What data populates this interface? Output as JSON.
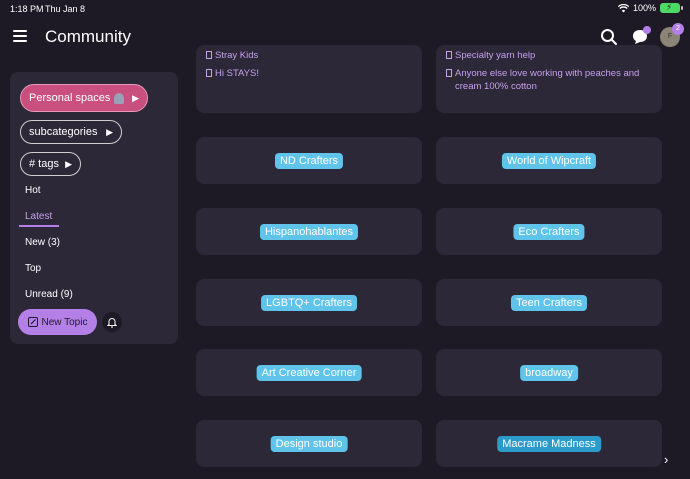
{
  "status": {
    "time": "1:18 PM",
    "date": "Thu Jan 8",
    "battery": "100%"
  },
  "header": {
    "title": "Community",
    "notifications_count": "2",
    "avatar_initials": "F"
  },
  "sidebar": {
    "personal_spaces": "Personal spaces",
    "subcategories": "subcategories",
    "tags": "# tags",
    "nav": [
      {
        "label": "Hot"
      },
      {
        "label": "Latest"
      },
      {
        "label": "New (3)"
      },
      {
        "label": "Top"
      },
      {
        "label": "Unread (9)"
      }
    ],
    "new_topic": "New Topic"
  },
  "top_cards": {
    "left": [
      "Stray Kids",
      "Hi STAYS!"
    ],
    "right": [
      "Specialty yarn help",
      "Anyone else love working with peaches and",
      "cream 100% cotton"
    ]
  },
  "categories": [
    {
      "name": "ND Crafters"
    },
    {
      "name": "World of Wipcraft"
    },
    {
      "name": "Hispanohablantes"
    },
    {
      "name": "Eco Crafters"
    },
    {
      "name": "LGBTQ+ Crafters"
    },
    {
      "name": "Teen Crafters"
    },
    {
      "name": "Art Creative Corner"
    },
    {
      "name": "broadway"
    },
    {
      "name": "Design studio"
    },
    {
      "name": "Macrame Madness"
    }
  ],
  "colors": {
    "background": "#1d1a26",
    "card": "#2c2838",
    "accent": "#b57fe8",
    "label_blue": "#5fc3ea",
    "personal_pink": "#c84f7e"
  },
  "icons": [
    "hamburger-icon",
    "search-icon",
    "chat-icon",
    "bell-icon",
    "pencil-icon",
    "chevron-right-icon",
    "wifi-icon",
    "battery-icon"
  ]
}
